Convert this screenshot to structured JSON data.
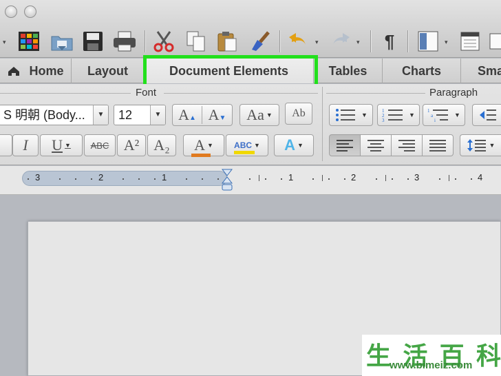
{
  "window": {
    "traffic_lights": [
      "close",
      "minimize"
    ]
  },
  "toolbar": {
    "buttons": [
      "gallery-icon",
      "templates-icon",
      "open-icon",
      "save-icon",
      "print-icon",
      "cut-icon",
      "copy-icon",
      "paste-icon",
      "format-painter-icon",
      "undo-icon",
      "redo-icon",
      "paragraph-marks-icon",
      "sidebar-icon",
      "view-icon"
    ],
    "pilcrow": "¶"
  },
  "ribbon_tabs": [
    "Home",
    "Layout",
    "Document Elements",
    "Tables",
    "Charts",
    "Sma"
  ],
  "active_tab": "Document Elements",
  "highlight_color": "#22e01c",
  "font_group": {
    "title": "Font",
    "font_name": "S 明朝 (Body...",
    "font_size": "12",
    "grow_label": "A",
    "shrink_label": "A",
    "case_label": "Aa",
    "clear_label": "Ab",
    "italic": "I",
    "underline": "U",
    "strike": "ABC",
    "superscript": "A²",
    "subscript": "A₂",
    "font_color_letter": "A",
    "highlight_text": "ABC",
    "text_effects": "A",
    "font_color": "#e07a1f",
    "highlight_swatch_color": "#f0d800"
  },
  "paragraph_group": {
    "title": "Paragraph"
  },
  "ruler": {
    "left_numbers": [
      "3",
      "2",
      "1"
    ],
    "right_numbers": [
      "1",
      "2",
      "3",
      "4"
    ]
  },
  "watermark": {
    "chars": [
      "生",
      "活",
      "百",
      "科"
    ],
    "url": "www.bimeiz.com"
  }
}
